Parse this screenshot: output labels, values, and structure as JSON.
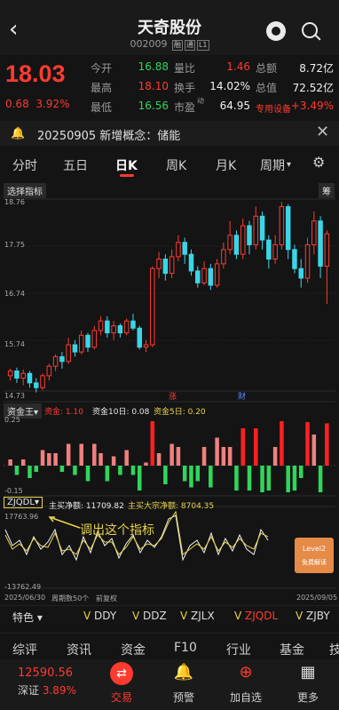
{
  "header": {
    "title": "天奇股份",
    "code": "002009",
    "tags": [
      "融",
      "通",
      "L1"
    ]
  },
  "quote": {
    "price": "18.03",
    "change": "0.68",
    "change_pct": "3.92%",
    "rows": [
      [
        {
          "label": "今开",
          "value": "16.88",
          "color": "green"
        },
        {
          "label": "量比",
          "value": "1.46",
          "color": "red"
        },
        {
          "label": "总额",
          "value": "8.72亿",
          "color": "white"
        }
      ],
      [
        {
          "label": "最高",
          "value": "18.10",
          "color": "red"
        },
        {
          "label": "换手",
          "value": "14.02%",
          "color": "white"
        },
        {
          "label": "总值",
          "value": "72.52亿",
          "color": "white"
        }
      ],
      [
        {
          "label": "最低",
          "value": "16.56",
          "color": "green"
        },
        {
          "label": "市盈",
          "value": "64.95",
          "color": "white",
          "sup": "动"
        },
        {
          "label": "专用设备",
          "value": "+3.49%",
          "color": "red"
        }
      ]
    ]
  },
  "notice": {
    "text": "20250905 新增概念：储能"
  },
  "period_tabs": [
    "分时",
    "五日",
    "日K",
    "周K",
    "月K",
    "周期"
  ],
  "active_tab": "日K",
  "chart": {
    "select_btn": "选择指标",
    "corner_btn": "筹",
    "price_axis": [
      "18.76",
      "17.75",
      "16.74",
      "15.74",
      "14.73"
    ],
    "markers": [
      "涨",
      "财"
    ],
    "fund_indicator": "资金王",
    "fund_labels": [
      "资金: 1.10",
      "资金10日: 0.08",
      "资金5日: 0.20"
    ],
    "fund_axis": [
      "0.25",
      "-0.15"
    ],
    "flow_indicator": "ZJQDL",
    "flow_labels": [
      "主买净额: 11709.82",
      "主买大宗净额: 8704.35"
    ],
    "flow_axis": [
      "17763.96",
      "-13762.49"
    ],
    "annotation": "调出这个指标",
    "date_start": "2025/06/30",
    "date_mid": "周期数50个",
    "date_mid2": "前复权",
    "date_end": "2025/09/05",
    "promo_title": "Level2",
    "promo_sub": "免费解读"
  },
  "indicator_bar": {
    "feature": "特色",
    "items": [
      "DDY",
      "DDZ",
      "ZJLX",
      "ZJQDL",
      "ZJBY"
    ]
  },
  "bottom_tabs": [
    "综评",
    "资讯",
    "资金",
    "F10",
    "行业",
    "基金",
    "技"
  ],
  "index": {
    "value": "12590.56",
    "name": "深证",
    "pct": "3.89%"
  },
  "nav": [
    "交易",
    "预警",
    "加自选",
    "更多"
  ],
  "chart_data": {
    "type": "candlestick",
    "ylim": [
      14.73,
      18.76
    ],
    "candles": [
      [
        15.05,
        15.15,
        15.2,
        14.95
      ],
      [
        15.15,
        15.0,
        15.22,
        14.9
      ],
      [
        15.0,
        15.1,
        15.18,
        14.85
      ],
      [
        15.1,
        14.9,
        15.15,
        14.8
      ],
      [
        14.9,
        14.8,
        15.0,
        14.7
      ],
      [
        14.8,
        15.05,
        15.1,
        14.75
      ],
      [
        15.05,
        15.25,
        15.3,
        14.95
      ],
      [
        15.25,
        15.45,
        15.5,
        15.15
      ],
      [
        15.45,
        15.35,
        15.55,
        15.2
      ],
      [
        15.35,
        15.7,
        15.85,
        15.3
      ],
      [
        15.7,
        15.55,
        15.8,
        15.45
      ],
      [
        15.55,
        15.9,
        16.0,
        15.5
      ],
      [
        15.9,
        15.65,
        15.95,
        15.55
      ],
      [
        15.65,
        16.0,
        16.1,
        15.6
      ],
      [
        16.0,
        16.2,
        16.3,
        15.9
      ],
      [
        16.2,
        15.95,
        16.3,
        15.85
      ],
      [
        15.95,
        16.1,
        16.2,
        15.8
      ],
      [
        16.1,
        15.95,
        16.15,
        15.85
      ],
      [
        15.95,
        16.2,
        16.25,
        15.9
      ],
      [
        16.2,
        16.05,
        16.35,
        16.0
      ],
      [
        16.05,
        15.65,
        16.1,
        15.6
      ],
      [
        15.65,
        15.7,
        15.8,
        15.55
      ],
      [
        15.7,
        17.3,
        17.35,
        15.65
      ],
      [
        17.3,
        17.5,
        17.65,
        17.1
      ],
      [
        17.5,
        17.2,
        17.6,
        17.05
      ],
      [
        17.2,
        17.55,
        17.7,
        17.1
      ],
      [
        17.55,
        17.85,
        18.0,
        17.45
      ],
      [
        17.85,
        17.6,
        17.95,
        17.4
      ],
      [
        17.6,
        17.25,
        17.7,
        17.15
      ],
      [
        17.25,
        17.0,
        17.35,
        16.9
      ],
      [
        17.0,
        17.3,
        17.45,
        16.95
      ],
      [
        17.3,
        16.95,
        17.4,
        16.85
      ],
      [
        16.95,
        17.4,
        17.5,
        16.9
      ],
      [
        17.4,
        17.7,
        17.85,
        17.3
      ],
      [
        17.7,
        18.0,
        18.3,
        17.6
      ],
      [
        18.0,
        17.6,
        18.1,
        17.5
      ],
      [
        17.6,
        18.2,
        18.35,
        17.5
      ],
      [
        18.2,
        17.8,
        18.3,
        17.6
      ],
      [
        17.8,
        18.4,
        18.6,
        17.7
      ],
      [
        18.4,
        17.9,
        18.5,
        17.7
      ],
      [
        17.9,
        17.5,
        18.0,
        17.3
      ],
      [
        17.5,
        17.8,
        18.0,
        17.4
      ],
      [
        17.8,
        18.6,
        18.7,
        17.7
      ],
      [
        18.6,
        17.7,
        18.65,
        17.5
      ],
      [
        17.7,
        17.3,
        17.8,
        17.2
      ],
      [
        17.3,
        17.1,
        17.5,
        16.9
      ],
      [
        17.1,
        17.8,
        17.95,
        17.0
      ],
      [
        17.8,
        18.3,
        18.5,
        17.6
      ],
      [
        18.3,
        17.35,
        18.4,
        17.1
      ],
      [
        17.35,
        18.03,
        18.1,
        16.56
      ]
    ]
  }
}
